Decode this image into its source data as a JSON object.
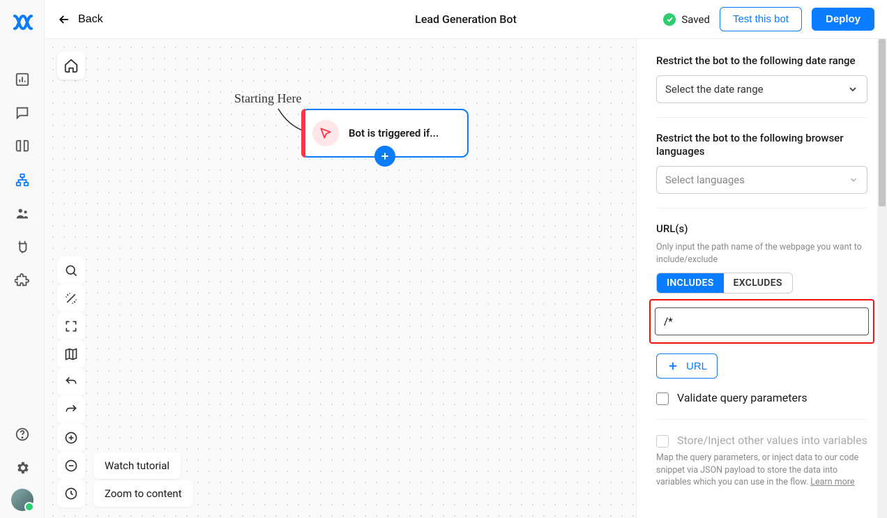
{
  "topbar": {
    "back": "Back",
    "title": "Lead Generation Bot",
    "saved": "Saved",
    "test": "Test this bot",
    "deploy": "Deploy"
  },
  "canvas": {
    "starting_here": "Starting Here",
    "trigger_text": "Bot is triggered if...",
    "watch_tutorial": "Watch tutorial",
    "zoom_to_content": "Zoom to content"
  },
  "panel": {
    "date_label": "Restrict the bot to the following date range",
    "date_placeholder": "Select the date range",
    "lang_label": "Restrict the bot to the following browser languages",
    "lang_placeholder": "Select languages",
    "urls_label": "URL(s)",
    "urls_hint": "Only input the path name of the webpage you want to include/exclude",
    "includes": "INCLUDES",
    "excludes": "EXCLUDES",
    "url_value": "/*",
    "add_url": "URL",
    "validate_qp": "Validate query parameters",
    "store_inject": "Store/Inject other values into variables",
    "store_hint": "Map the query parameters, or inject data to our code snippet via JSON payload to store the data into variables which you can use in the flow. ",
    "learn_more": "Learn more"
  }
}
